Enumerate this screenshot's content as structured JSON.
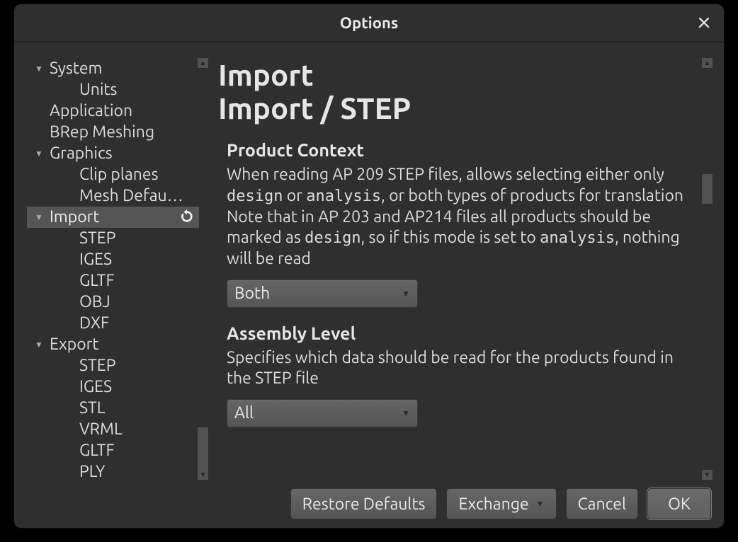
{
  "window": {
    "title": "Options"
  },
  "tree": {
    "system": "System",
    "units": "Units",
    "application": "Application",
    "brep": "BRep Meshing",
    "graphics": "Graphics",
    "clip": "Clip planes",
    "mesh": "Mesh Defau…",
    "import": "Import",
    "imp_step": "STEP",
    "imp_iges": "IGES",
    "imp_gltf": "GLTF",
    "imp_obj": "OBJ",
    "imp_dxf": "DXF",
    "export": "Export",
    "exp_step": "STEP",
    "exp_iges": "IGES",
    "exp_stl": "STL",
    "exp_vrml": "VRML",
    "exp_gltf": "GLTF",
    "exp_ply": "PLY"
  },
  "main": {
    "h1a": "Import",
    "h1b": "Import / STEP",
    "sec1": "Product Context",
    "desc1a": "When reading AP 209 STEP files, allows selecting either only ",
    "desc1b": " or ",
    "desc1c": ", or both types of products for translation",
    "desc1d": "Note that in AP 203 and AP214 files all products should be marked as ",
    "desc1e": ", so if this mode is set to ",
    "desc1f": ", nothing will be read",
    "code_design": "design",
    "code_analysis": "analysis",
    "combo1": "Both",
    "sec2": "Assembly Level",
    "desc2": "Specifies which data should be read for the products found in the STEP file",
    "combo2": "All"
  },
  "footer": {
    "restore": "Restore Defaults",
    "exchange": "Exchange",
    "cancel": "Cancel",
    "ok": "OK"
  }
}
